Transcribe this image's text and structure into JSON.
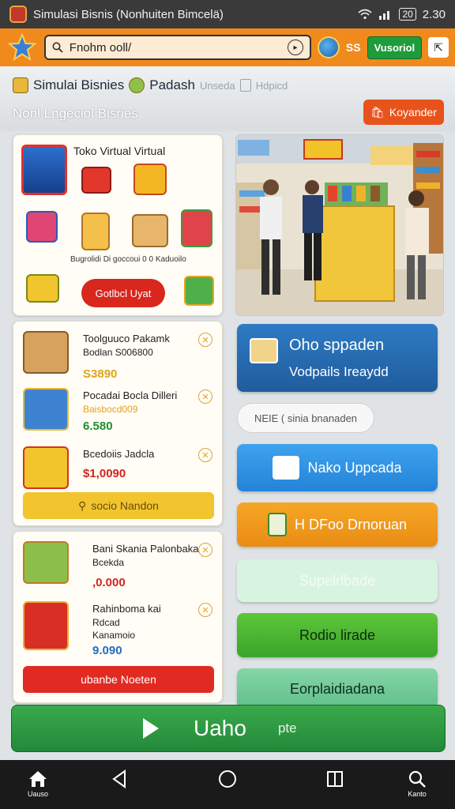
{
  "status": {
    "title": "Simulasi Bisnis (Nonhuiten Bimcelä)",
    "battery": "20",
    "time": "2.30"
  },
  "topbar": {
    "search_value": "Fnohm ooll/",
    "ss": "SS",
    "green_label": "Vusoriol"
  },
  "subheader": {
    "crumb1": "Simulai Bisnies",
    "crumb2": "Padash",
    "crumb3": "Unseda",
    "crumb4": "Hdpicd",
    "subtitle": "Nonl Lngeciol Bisries",
    "orange_button": "Koyander"
  },
  "card1": {
    "title": "Toko Virtual Virtual",
    "captions": "Bugrolidi Di   goccoui   0 0   Kaduoilo",
    "cta": "Gotlbcl Uyat"
  },
  "card2": {
    "items": [
      {
        "title": "Toolguuco Pakamk",
        "subtitle": "Bodlan S006800",
        "price": "S3890",
        "price_color": "#e2a31b"
      },
      {
        "title": "Pocadai Bocla Dilleri",
        "subtitle": "Baisbocd009",
        "price": "6.580",
        "price_color": "#1f8f2e"
      },
      {
        "title": "Bcedoiis Jadcla",
        "subtitle": "",
        "price": "$1,0090",
        "price_color": "#d3241d"
      }
    ],
    "button": "socio Nandon"
  },
  "card3": {
    "items": [
      {
        "title": "Bani Skania Palonbaka",
        "subtitle": "Bcekda",
        "price": ",0.000",
        "price_color": "#d3241d"
      },
      {
        "title": "Rahinboma kai",
        "subtitle": "Rdcad",
        "subtitle2": "Kanamoio",
        "price": "9.090",
        "price_color": "#1f6fbf"
      }
    ],
    "button": "ubanbe Noeten"
  },
  "right": {
    "btn1_line1": "Oho sppaden",
    "btn1_line2": "Vodpails Ireaydd",
    "chip": "NEIE ( sinia bnanaden",
    "btn2": "Nako Uppcada",
    "btn3": "H DFoo Drnoruan",
    "btn4": "Supelrlbade",
    "btn5": "Rodio lirade",
    "btn6": "Eorplaidiadana"
  },
  "playbar": {
    "label": "Uaho",
    "sub": "pte"
  },
  "navbar": {
    "home": "Uauso",
    "search": "Kanto"
  }
}
